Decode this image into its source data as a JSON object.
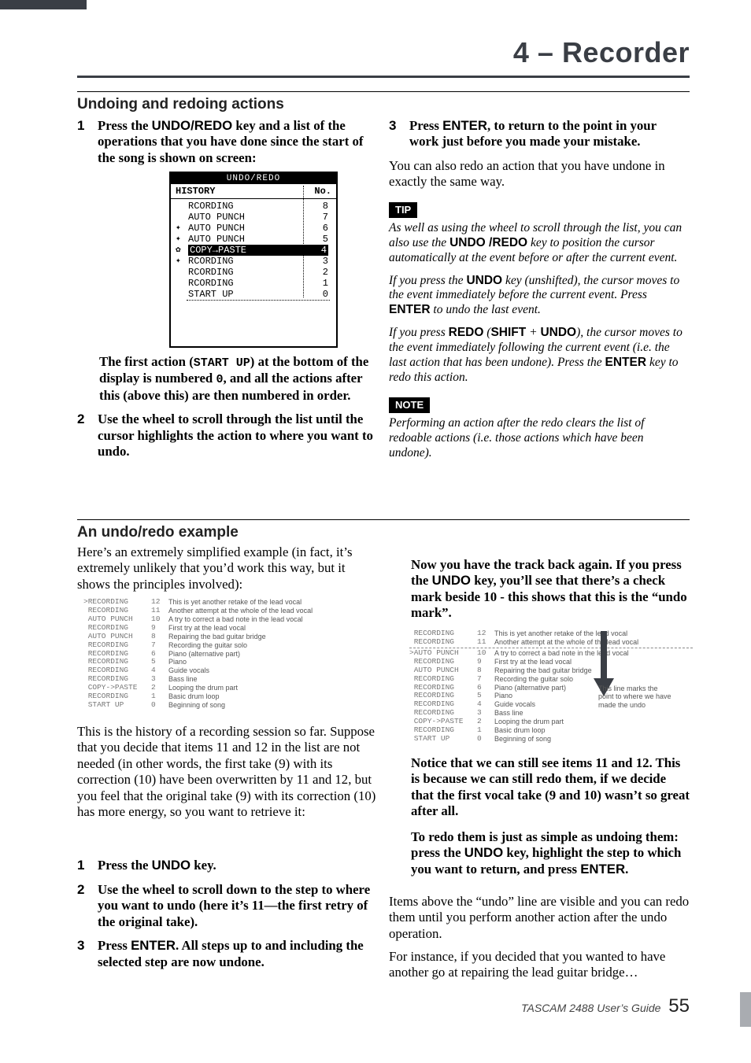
{
  "chapter": "4 – Recorder",
  "section1": {
    "title": "Undoing and redoing actions",
    "step1_pre": "Press the ",
    "step1_key": "UNDO/REDO",
    "step1_post": " key and a list of the operations that you have done since the start of the song is shown on screen:",
    "device": {
      "title": "UNDO/REDO",
      "hdr_l": "HISTORY",
      "hdr_r": "No.",
      "rows": [
        {
          "label": "RCORDING",
          "no": "8",
          "marker": ""
        },
        {
          "label": "AUTO PUNCH",
          "no": "7",
          "marker": ""
        },
        {
          "label": "AUTO PUNCH",
          "no": "6",
          "marker": "✦"
        },
        {
          "label": "AUTO PUNCH",
          "no": "5",
          "marker": "✦"
        },
        {
          "label": "COPY→PASTE",
          "no": "4",
          "marker": "✿",
          "sel": true
        },
        {
          "label": "RCORDING",
          "no": "3",
          "marker": "✦"
        },
        {
          "label": "RCORDING",
          "no": "2",
          "marker": ""
        },
        {
          "label": "RCORDING",
          "no": "1",
          "marker": ""
        },
        {
          "label": "START UP",
          "no": "0",
          "marker": ""
        }
      ]
    },
    "after_device_1": "The first action (",
    "after_device_mono1": "START UP",
    "after_device_2": ") at the bottom of the display is numbered ",
    "after_device_mono2": "0",
    "after_device_3": ", and all the actions after this (above this) are then numbered in order.",
    "step2": "Use the wheel to scroll through the list until the cursor highlights the action to where you want to undo.",
    "step3_pre": "Press ",
    "step3_key": "ENTER",
    "step3_post": ", to return to the point in your work just before you made your mistake.",
    "righttext": "You can also redo an action that you have undone in exactly the same way.",
    "tip_label": "TIP",
    "tip1_pre": "As well as using the wheel to scroll through the list, you can also use the ",
    "tip1_key": "UNDO /REDO",
    "tip1_post": " key to position the cursor automatically at the event before or after the current event.",
    "tip2_a": "If you press the ",
    "tip2_key1": "UNDO",
    "tip2_b": " key (unshifted), the cursor moves to the event immediately before the current event. Press ",
    "tip2_key2": "ENTER",
    "tip2_c": " to undo the last event.",
    "tip3_a": "If you press ",
    "tip3_key1": "REDO",
    "tip3_b": " (",
    "tip3_key2": "SHIFT",
    "tip3_c": " + ",
    "tip3_key3": "UNDO",
    "tip3_d": "), the cursor moves to the event immediately following the current event (i.e. the last action that has been undone). Press the ",
    "tip3_key4": "ENTER",
    "tip3_e": " key to redo this action.",
    "note_label": "NOTE",
    "note": "Performing an action after the redo clears the list of redoable actions (i.e. those actions which have been undone)."
  },
  "section2": {
    "title": "An undo/redo example",
    "intro": "Here’s an extremely simplified example (in fact, it’s extremely unlikely that you’d work this way, but it shows the principles involved):",
    "history1": [
      {
        "op": ">RECORDING",
        "n": "12",
        "d": "This is yet another retake of the lead vocal"
      },
      {
        "op": " RECORDING",
        "n": "11",
        "d": "Another attempt at the whole of the lead vocal"
      },
      {
        "op": " AUTO PUNCH",
        "n": "10",
        "d": "A try to correct a bad note in the lead vocal"
      },
      {
        "op": " RECORDING",
        "n": "9",
        "d": "First try at the lead vocal"
      },
      {
        "op": " AUTO PUNCH",
        "n": "8",
        "d": "Repairing the bad guitar bridge"
      },
      {
        "op": " RECORDING",
        "n": "7",
        "d": "Recording the guitar solo"
      },
      {
        "op": " RECORDING",
        "n": "6",
        "d": "Piano (alternative part)"
      },
      {
        "op": " RECORDING",
        "n": "5",
        "d": "Piano"
      },
      {
        "op": " RECORDING",
        "n": "4",
        "d": "Guide vocals"
      },
      {
        "op": " RECORDING",
        "n": "3",
        "d": "Bass line"
      },
      {
        "op": " COPY->PASTE",
        "n": "2",
        "d": "Looping the drum part"
      },
      {
        "op": " RECORDING",
        "n": "1",
        "d": "Basic drum loop"
      },
      {
        "op": " START UP",
        "n": "0",
        "d": "Beginning of song"
      }
    ],
    "para2": "This is the history of a recording session so far. Suppose that you decide that items 11 and 12 in the list are not needed (in other words, the first take (9) with its correction (10) have been overwritten by 11 and 12, but you feel that the original take (9) with its correction (10) has more energy, so you want to retrieve it:",
    "step1_pre": "Press the ",
    "step1_key": "UNDO",
    "step1_post": " key.",
    "step2": "Use the wheel to scroll down to the step to where you want to undo (here it’s 11—the first retry of the original take).",
    "step3_pre": "Press ",
    "step3_key": "ENTER",
    "step3_post": ". All steps up to and including the selected step are now undone.",
    "right_intro_a": "Now you have the track back again. If you press the ",
    "right_intro_key": "UNDO",
    "right_intro_b": " key, you’ll see that there’s a check mark beside 10 - this shows that this is the “undo mark”.",
    "history2": [
      {
        "op": " RECORDING",
        "n": "12",
        "d": "This is yet another retake of the lead vocal"
      },
      {
        "op": " RECORDING",
        "n": "11",
        "d": "Another attempt at the whole of the lead vocal"
      },
      {
        "op": ">AUTO PUNCH",
        "n": "10",
        "d": "A try to correct a bad note in the lead vocal",
        "dashed": true
      },
      {
        "op": " RECORDING",
        "n": "9",
        "d": "First try at the lead vocal"
      },
      {
        "op": " AUTO PUNCH",
        "n": "8",
        "d": "Repairing the bad guitar bridge"
      },
      {
        "op": " RECORDING",
        "n": "7",
        "d": "Recording the guitar solo"
      },
      {
        "op": " RECORDING",
        "n": "6",
        "d": "Piano (alternative part)"
      },
      {
        "op": " RECORDING",
        "n": "5",
        "d": "Piano"
      },
      {
        "op": " RECORDING",
        "n": "4",
        "d": "Guide vocals"
      },
      {
        "op": " RECORDING",
        "n": "3",
        "d": "Bass line"
      },
      {
        "op": " COPY->PASTE",
        "n": "2",
        "d": "Looping the drum part"
      },
      {
        "op": " RECORDING",
        "n": "1",
        "d": "Basic drum loop"
      },
      {
        "op": " START UP",
        "n": "0",
        "d": "Beginning of song"
      }
    ],
    "callout1": "This line marks the",
    "callout2": "point to where we have",
    "callout3": "made the undo",
    "right_p2": "Notice that we can still see items 11 and 12. This is because we can still redo them, if we decide that the first vocal take (9 and 10) wasn’t so great after all.",
    "right_p3_a": "To redo them is just as simple as undoing them: press the ",
    "right_p3_key1": "UNDO",
    "right_p3_b": " key, highlight the step to which you want to return, and press ",
    "right_p3_key2": "ENTER",
    "right_p3_c": ".",
    "right_p4": "Items above the “undo” line are visible and you can redo them until you perform another action after the undo operation.",
    "right_p5": "For instance, if you decided that you wanted to have another go at repairing the lead guitar bridge…"
  },
  "footer": {
    "guide": "TASCAM 2488 User’s Guide",
    "page": "55"
  }
}
